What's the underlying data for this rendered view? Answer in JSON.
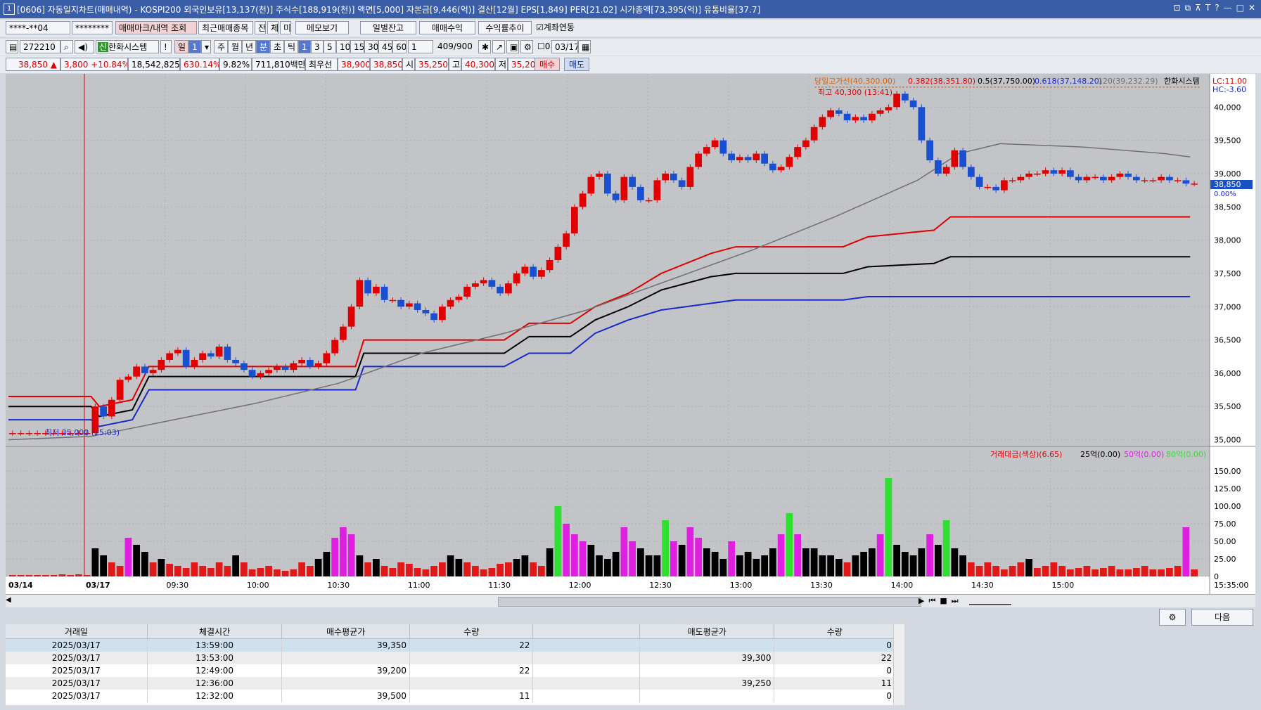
{
  "window": {
    "screen_id": "1",
    "title": "[0606] 자동일지차트(매매내역) - KOSPI200 외국인보유[13,137(천)] 주식수[188,919(천)] 액면[5,000] 자본금[9,446(억)] 결산[12월] EPS[1,849] PER[21.02] 시가총액[73,395(억)] 유통비율[37.7]",
    "controls": [
      "⊡",
      "⧉",
      "⊼",
      "T",
      "?",
      "—",
      "□",
      "✕"
    ]
  },
  "toolbar1": {
    "account": "****-**04",
    "password": "********",
    "btn_trade_history": "매매마크/내역 조회",
    "btn_recent_trade": "최근매매종목",
    "btn_jan": "잔",
    "btn_che": "체",
    "btn_mi": "미",
    "btn_memo": "메모보기",
    "btn_daily_balance": "일별잔고",
    "btn_trade_profit": "매매수익",
    "btn_profit_trend": "수익률추이",
    "chk_account_link": "계좌연동"
  },
  "toolbar2": {
    "code": "272210",
    "name": "한화시스템",
    "badge": "신",
    "excl": "!",
    "day": "일",
    "day_val": "1",
    "periods": [
      "주",
      "월",
      "년",
      "분",
      "초",
      "틱"
    ],
    "minute_selected": "1",
    "minute_opts": [
      "3",
      "5",
      "10",
      "15",
      "30",
      "45",
      "60"
    ],
    "interval": "1",
    "count": "409/900",
    "zero": "0",
    "date": "03/17"
  },
  "quote": {
    "price": "38,850 ▲",
    "change": "3,800 +10.84%",
    "volume": "18,542,825",
    "vol_rate": "630.14%",
    "turnover": "9.82%",
    "amount": "711,810백만",
    "best_ask_label": "최우선",
    "best_ask": "38,900",
    "best_bid": "38,850",
    "open_label": "시",
    "open": "35,250",
    "high_label": "고",
    "high": "40,300",
    "low_label": "저",
    "low": "35,200",
    "btn_buy": "매수",
    "btn_sell": "매도"
  },
  "chart_data": {
    "type": "candlestick",
    "legend": {
      "high_line": "당일고가선(40,300.00)",
      "fib_382": "0.382(38,351.80)",
      "fib_5": "0.5(37,750.00)",
      "fib_618": "0.618(37,148.20)",
      "ma120": "120(39,232.29)",
      "name": "한화시스템"
    },
    "lc": "LC:11.00",
    "hc": "HC:-3.60",
    "high_annotation": "최고 40,300 (13:41)",
    "low_annotation": "최저 35,000 (15:03)",
    "current_price_tag": "38,850",
    "current_pct_tag": "0.00%",
    "price_axis": [
      "40,000",
      "39,500",
      "39,000",
      "38,500",
      "38,000",
      "37,500",
      "37,000",
      "36,500",
      "36,000",
      "35,500",
      "35,000"
    ],
    "ylim": [
      34900,
      40500
    ],
    "volume_legend": {
      "label": "거래대금(색상)(6.65)",
      "l25": "25억(0.00)",
      "l50": "50억(0.00)",
      "l80": "80억(0.00)"
    },
    "volume_axis": [
      "150.00",
      "125.00",
      "100.00",
      "75.00",
      "50.00",
      "25.00",
      "0"
    ],
    "time_axis": [
      "03/14",
      "03/17",
      "09:30",
      "10:00",
      "10:30",
      "11:00",
      "11:30",
      "12:00",
      "12:30",
      "13:00",
      "13:30",
      "14:00",
      "14:30",
      "15:00",
      "15:35:00"
    ],
    "series": [
      {
        "name": "0.382",
        "color": "#e00000",
        "values": [
          [
            0,
            35650
          ],
          [
            10,
            35650
          ],
          [
            11,
            35500
          ],
          [
            15,
            35600
          ],
          [
            17,
            36100
          ],
          [
            42,
            36100
          ],
          [
            43,
            36500
          ],
          [
            60,
            36500
          ],
          [
            63,
            36750
          ],
          [
            68,
            36750
          ],
          [
            71,
            37000
          ],
          [
            75,
            37200
          ],
          [
            79,
            37500
          ],
          [
            85,
            37800
          ],
          [
            88,
            37900
          ],
          [
            101,
            37900
          ],
          [
            104,
            38050
          ],
          [
            112,
            38150
          ],
          [
            114,
            38350
          ],
          [
            143,
            38350
          ]
        ]
      },
      {
        "name": "0.5",
        "color": "#000000",
        "values": [
          [
            0,
            35500
          ],
          [
            10,
            35500
          ],
          [
            11,
            35350
          ],
          [
            15,
            35450
          ],
          [
            17,
            35950
          ],
          [
            42,
            35950
          ],
          [
            43,
            36300
          ],
          [
            60,
            36300
          ],
          [
            63,
            36550
          ],
          [
            68,
            36550
          ],
          [
            71,
            36800
          ],
          [
            75,
            37000
          ],
          [
            79,
            37250
          ],
          [
            85,
            37450
          ],
          [
            88,
            37500
          ],
          [
            101,
            37500
          ],
          [
            104,
            37600
          ],
          [
            112,
            37650
          ],
          [
            114,
            37750
          ],
          [
            143,
            37750
          ]
        ]
      },
      {
        "name": "0.618",
        "color": "#1a28c8",
        "values": [
          [
            0,
            35300
          ],
          [
            10,
            35300
          ],
          [
            11,
            35200
          ],
          [
            15,
            35300
          ],
          [
            17,
            35750
          ],
          [
            42,
            35750
          ],
          [
            43,
            36100
          ],
          [
            60,
            36100
          ],
          [
            63,
            36300
          ],
          [
            68,
            36300
          ],
          [
            71,
            36600
          ],
          [
            75,
            36800
          ],
          [
            79,
            36950
          ],
          [
            85,
            37050
          ],
          [
            88,
            37100
          ],
          [
            101,
            37100
          ],
          [
            104,
            37150
          ],
          [
            112,
            37150
          ],
          [
            114,
            37150
          ],
          [
            143,
            37150
          ]
        ]
      },
      {
        "name": "120",
        "color": "#707070",
        "values": [
          [
            0,
            35000
          ],
          [
            10,
            35050
          ],
          [
            20,
            35300
          ],
          [
            30,
            35550
          ],
          [
            40,
            35850
          ],
          [
            50,
            36300
          ],
          [
            60,
            36600
          ],
          [
            70,
            36950
          ],
          [
            80,
            37400
          ],
          [
            90,
            37850
          ],
          [
            100,
            38350
          ],
          [
            110,
            38900
          ],
          [
            115,
            39300
          ],
          [
            120,
            39450
          ],
          [
            130,
            39400
          ],
          [
            140,
            39300
          ],
          [
            143,
            39250
          ]
        ]
      }
    ],
    "close_values": [
      35100,
      35100,
      35100,
      35100,
      35100,
      35100,
      35100,
      35100,
      35100,
      35100,
      35500,
      35350,
      35600,
      35900,
      35950,
      36100,
      36000,
      36050,
      36200,
      36300,
      36350,
      36100,
      36200,
      36300,
      36250,
      36400,
      36200,
      36150,
      36050,
      35950,
      36000,
      36050,
      36100,
      36050,
      36150,
      36200,
      36100,
      36150,
      36300,
      36500,
      36700,
      37000,
      37400,
      37200,
      37300,
      37100,
      37100,
      37000,
      37050,
      36950,
      36900,
      36800,
      37000,
      37100,
      37150,
      37300,
      37350,
      37400,
      37300,
      37200,
      37350,
      37500,
      37600,
      37450,
      37550,
      37700,
      37900,
      38100,
      38500,
      38700,
      38950,
      39000,
      38700,
      38600,
      38950,
      38800,
      38600,
      38600,
      38900,
      39000,
      38900,
      38800,
      39100,
      39300,
      39400,
      39500,
      39300,
      39200,
      39250,
      39200,
      39300,
      39150,
      39050,
      39100,
      39250,
      39400,
      39500,
      39700,
      39850,
      39950,
      39900,
      39800,
      39850,
      39800,
      39900,
      39950,
      40000,
      40200,
      40100,
      40000,
      39500,
      39200,
      39000,
      39100,
      39350,
      39100,
      38950,
      38800,
      38800,
      38750,
      38900,
      38900,
      38950,
      39000,
      39000,
      39050,
      39000,
      39050,
      38950,
      38900,
      38950,
      38950,
      38900,
      38950,
      39000,
      38950,
      38900,
      38900,
      38900,
      38950,
      38900,
      38900,
      38850,
      38850
    ],
    "volume_values": [
      2,
      2,
      2,
      2,
      2,
      2,
      3,
      2,
      3,
      2,
      40,
      30,
      20,
      15,
      55,
      45,
      35,
      20,
      25,
      18,
      15,
      12,
      20,
      15,
      12,
      20,
      15,
      30,
      20,
      10,
      12,
      15,
      10,
      8,
      10,
      20,
      15,
      25,
      35,
      55,
      70,
      60,
      30,
      20,
      25,
      15,
      12,
      20,
      18,
      12,
      10,
      15,
      20,
      30,
      25,
      20,
      15,
      10,
      12,
      18,
      20,
      25,
      30,
      20,
      15,
      40,
      100,
      75,
      60,
      50,
      45,
      30,
      25,
      35,
      70,
      50,
      40,
      30,
      30,
      80,
      50,
      45,
      70,
      55,
      40,
      35,
      25,
      50,
      30,
      35,
      25,
      30,
      40,
      60,
      90,
      60,
      40,
      40,
      30,
      30,
      25,
      20,
      30,
      35,
      40,
      60,
      140,
      45,
      35,
      30,
      40,
      60,
      45,
      80,
      40,
      30,
      20,
      15,
      20,
      15,
      10,
      15,
      20,
      25,
      12,
      15,
      20,
      15,
      10,
      12,
      15,
      10,
      12,
      15,
      10,
      10,
      12,
      15,
      10,
      10,
      12,
      15,
      70,
      10
    ]
  },
  "scroll_controls": [
    "▶",
    "⏮",
    "■",
    "⏭"
  ],
  "bottom_buttons": {
    "settings": "⚙",
    "next": "다음"
  },
  "table": {
    "headers": [
      "거래일",
      "체결시간",
      "매수평균가",
      "수량",
      "",
      "매도평균가",
      "수량"
    ],
    "rows": [
      [
        "2025/03/17",
        "13:59:00",
        "39,350",
        "22",
        "",
        "",
        "0"
      ],
      [
        "2025/03/17",
        "13:53:00",
        "",
        "",
        "",
        "39,300",
        "22"
      ],
      [
        "2025/03/17",
        "12:49:00",
        "39,200",
        "22",
        "",
        "",
        "0"
      ],
      [
        "2025/03/17",
        "12:36:00",
        "",
        "",
        "",
        "39,250",
        "11"
      ],
      [
        "2025/03/17",
        "12:32:00",
        "39,500",
        "11",
        "",
        "",
        "0"
      ]
    ]
  }
}
